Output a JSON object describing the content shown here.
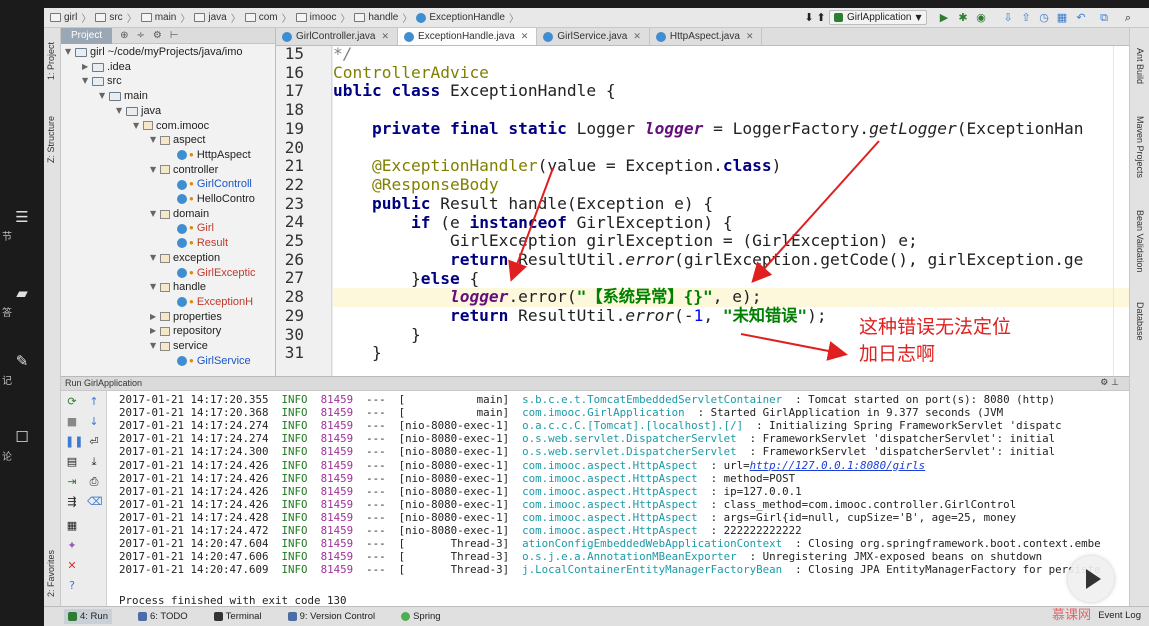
{
  "player_sidebar": [
    {
      "icon": "list-icon",
      "label": "节"
    },
    {
      "icon": "chat-icon",
      "label": "答"
    },
    {
      "icon": "note-icon",
      "label": "记"
    },
    {
      "icon": "comment-icon",
      "label": "论"
    }
  ],
  "breadcrumb": [
    "girl",
    "src",
    "main",
    "java",
    "com",
    "imooc",
    "handle",
    "ExceptionHandle"
  ],
  "run_config": "GirlApplication",
  "project": {
    "tab": "Project",
    "tree": [
      {
        "label": "girl ~/code/myProjects/java/imo",
        "depth": 0,
        "type": "folder",
        "open": true
      },
      {
        "label": ".idea",
        "depth": 1,
        "type": "folder",
        "open": false
      },
      {
        "label": "src",
        "depth": 1,
        "type": "folder",
        "open": true
      },
      {
        "label": "main",
        "depth": 2,
        "type": "folder",
        "open": true
      },
      {
        "label": "java",
        "depth": 3,
        "type": "folder",
        "open": true
      },
      {
        "label": "com.imooc",
        "depth": 4,
        "type": "pkg",
        "open": true
      },
      {
        "label": "aspect",
        "depth": 5,
        "type": "pkg",
        "open": true
      },
      {
        "label": "HttpAspect",
        "depth": 6,
        "type": "class",
        "color": "plain"
      },
      {
        "label": "controller",
        "depth": 5,
        "type": "pkg",
        "open": true
      },
      {
        "label": "GirlControll",
        "depth": 6,
        "type": "class",
        "color": "blue"
      },
      {
        "label": "HelloContro",
        "depth": 6,
        "type": "class",
        "color": "plain"
      },
      {
        "label": "domain",
        "depth": 5,
        "type": "pkg",
        "open": true
      },
      {
        "label": "Girl",
        "depth": 6,
        "type": "class",
        "color": "orange"
      },
      {
        "label": "Result",
        "depth": 6,
        "type": "class",
        "color": "orange"
      },
      {
        "label": "exception",
        "depth": 5,
        "type": "pkg",
        "open": true
      },
      {
        "label": "GirlExceptic",
        "depth": 6,
        "type": "class",
        "color": "orange"
      },
      {
        "label": "handle",
        "depth": 5,
        "type": "pkg",
        "open": true
      },
      {
        "label": "ExceptionH",
        "depth": 6,
        "type": "class",
        "color": "orange"
      },
      {
        "label": "properties",
        "depth": 5,
        "type": "pkg",
        "open": false
      },
      {
        "label": "repository",
        "depth": 5,
        "type": "pkg",
        "open": false
      },
      {
        "label": "service",
        "depth": 5,
        "type": "pkg",
        "open": true
      },
      {
        "label": "GirlService",
        "depth": 6,
        "type": "class",
        "color": "blue"
      }
    ]
  },
  "editor_tabs": [
    {
      "label": "GirlController.java",
      "active": false
    },
    {
      "label": "ExceptionHandle.java",
      "active": true
    },
    {
      "label": "GirlService.java",
      "active": false
    },
    {
      "label": "HttpAspect.java",
      "active": false
    }
  ],
  "line_numbers": [
    "15",
    "16",
    "17",
    "18",
    "19",
    "20",
    "21",
    "22",
    "23",
    "24",
    "25",
    "26",
    "27",
    "28",
    "29",
    "30",
    "31"
  ],
  "code": {
    "l15": "*/",
    "l16": "ControllerAdvice",
    "l17_kw": "ublic class ",
    "l17_rest": "ExceptionHandle {",
    "l19_kw": "    private final static ",
    "l19_a": "Logger ",
    "l19_fld": "logger",
    "l19_b": " = LoggerFactory.",
    "l19_it": "getLogger",
    "l19_c": "(ExceptionHan",
    "l21_ann": "    @ExceptionHandler",
    "l21_a": "(value = Exception.",
    "l21_kw": "class",
    "l21_b": ")",
    "l22_ann": "    @ResponseBody",
    "l23_kw": "    public ",
    "l23_rest": "Result handle(Exception e) {",
    "l24_kw1": "        if ",
    "l24_a": "(e ",
    "l24_kw2": "instanceof ",
    "l24_b": "GirlException) {",
    "l25": "            GirlException girlException = (GirlException) e;",
    "l26_kw": "            return ",
    "l26_a": "ResultUtil.",
    "l26_it": "error",
    "l26_b": "(girlException.getCode(), girlException.ge",
    "l27_a": "        }",
    "l27_kw": "else ",
    "l27_b": "{",
    "l28_pre": "            ",
    "l28_fld": "logger",
    "l28_a": ".error(",
    "l28_str": "\"【系统异常】{}\"",
    "l28_b": ", e);",
    "l29_kw": "            return ",
    "l29_a": "ResultUtil.",
    "l29_it": "error",
    "l29_b": "(-",
    "l29_num": "1",
    "l29_c": ", ",
    "l29_str": "\"未知错误\"",
    "l29_d": ");",
    "l30": "        }",
    "l31": "    }"
  },
  "annotation": {
    "line1": "这种错误无法定位",
    "line2": "加日志啊",
    "color": "#e02020"
  },
  "run_panel": {
    "title": "Run  GirlApplication",
    "logs": [
      {
        "ts": "2017-01-21 14:17:20.355",
        "lvl": "INFO",
        "pid": "81459",
        "thr": "---  [           main]",
        "logger": "s.b.c.e.t.TomcatEmbeddedServletContainer",
        "msg": ": Tomcat started on port(s): 8080 (http)"
      },
      {
        "ts": "2017-01-21 14:17:20.368",
        "lvl": "INFO",
        "pid": "81459",
        "thr": "---  [           main]",
        "logger": "com.imooc.GirlApplication",
        "msg": ": Started GirlApplication in 9.377 seconds (JVM"
      },
      {
        "ts": "2017-01-21 14:17:24.274",
        "lvl": "INFO",
        "pid": "81459",
        "thr": "---  [nio-8080-exec-1]",
        "logger": "o.a.c.c.C.[Tomcat].[localhost].[/]",
        "msg": ": Initializing Spring FrameworkServlet 'dispatc"
      },
      {
        "ts": "2017-01-21 14:17:24.274",
        "lvl": "INFO",
        "pid": "81459",
        "thr": "---  [nio-8080-exec-1]",
        "logger": "o.s.web.servlet.DispatcherServlet",
        "msg": ": FrameworkServlet 'dispatcherServlet': initial"
      },
      {
        "ts": "2017-01-21 14:17:24.300",
        "lvl": "INFO",
        "pid": "81459",
        "thr": "---  [nio-8080-exec-1]",
        "logger": "o.s.web.servlet.DispatcherServlet",
        "msg": ": FrameworkServlet 'dispatcherServlet': initial"
      },
      {
        "ts": "2017-01-21 14:17:24.426",
        "lvl": "INFO",
        "pid": "81459",
        "thr": "---  [nio-8080-exec-1]",
        "logger": "com.imooc.aspect.HttpAspect",
        "msg": ": url=",
        "url": "http://127.0.0.1:8080/girls"
      },
      {
        "ts": "2017-01-21 14:17:24.426",
        "lvl": "INFO",
        "pid": "81459",
        "thr": "---  [nio-8080-exec-1]",
        "logger": "com.imooc.aspect.HttpAspect",
        "msg": ": method=POST"
      },
      {
        "ts": "2017-01-21 14:17:24.426",
        "lvl": "INFO",
        "pid": "81459",
        "thr": "---  [nio-8080-exec-1]",
        "logger": "com.imooc.aspect.HttpAspect",
        "msg": ": ip=127.0.0.1"
      },
      {
        "ts": "2017-01-21 14:17:24.426",
        "lvl": "INFO",
        "pid": "81459",
        "thr": "---  [nio-8080-exec-1]",
        "logger": "com.imooc.aspect.HttpAspect",
        "msg": ": class_method=com.imooc.controller.GirlControl"
      },
      {
        "ts": "2017-01-21 14:17:24.428",
        "lvl": "INFO",
        "pid": "81459",
        "thr": "---  [nio-8080-exec-1]",
        "logger": "com.imooc.aspect.HttpAspect",
        "msg": ": args=Girl{id=null, cupSize='B', age=25, money"
      },
      {
        "ts": "2017-01-21 14:17:24.472",
        "lvl": "INFO",
        "pid": "81459",
        "thr": "---  [nio-8080-exec-1]",
        "logger": "com.imooc.aspect.HttpAspect",
        "msg": ": 222222222222"
      },
      {
        "ts": "2017-01-21 14:20:47.604",
        "lvl": "INFO",
        "pid": "81459",
        "thr": "---  [       Thread-3]",
        "logger": "ationConfigEmbeddedWebApplicationContext",
        "msg": ": Closing org.springframework.boot.context.embe"
      },
      {
        "ts": "2017-01-21 14:20:47.606",
        "lvl": "INFO",
        "pid": "81459",
        "thr": "---  [       Thread-3]",
        "logger": "o.s.j.e.a.AnnotationMBeanExporter",
        "msg": ": Unregistering JMX-exposed beans on shutdown"
      },
      {
        "ts": "2017-01-21 14:20:47.609",
        "lvl": "INFO",
        "pid": "81459",
        "thr": "---  [       Thread-3]",
        "logger": "j.LocalContainerEntityManagerFactoryBean",
        "msg": ": Closing JPA EntityManagerFactory for persiste"
      }
    ],
    "exit": "Process finished with exit code 130"
  },
  "left_tool_tabs": [
    "1: Project",
    "Z: Structure",
    "2: Favorites"
  ],
  "right_tool_tabs": [
    "Ant Build",
    "Maven Projects",
    "Bean Validation",
    "Database"
  ],
  "bottom_bar": [
    {
      "label": "4: Run",
      "color": "#2e7d32",
      "active": true
    },
    {
      "label": "6: TODO",
      "color": "#4a6da7",
      "active": false
    },
    {
      "label": "Terminal",
      "color": "#333333",
      "active": false
    },
    {
      "label": "9: Version Control",
      "color": "#4a6da7",
      "active": false
    },
    {
      "label": "Spring",
      "color": "#4caf50",
      "active": false
    }
  ],
  "event_log": "Event Log",
  "watermark": "慕课网"
}
